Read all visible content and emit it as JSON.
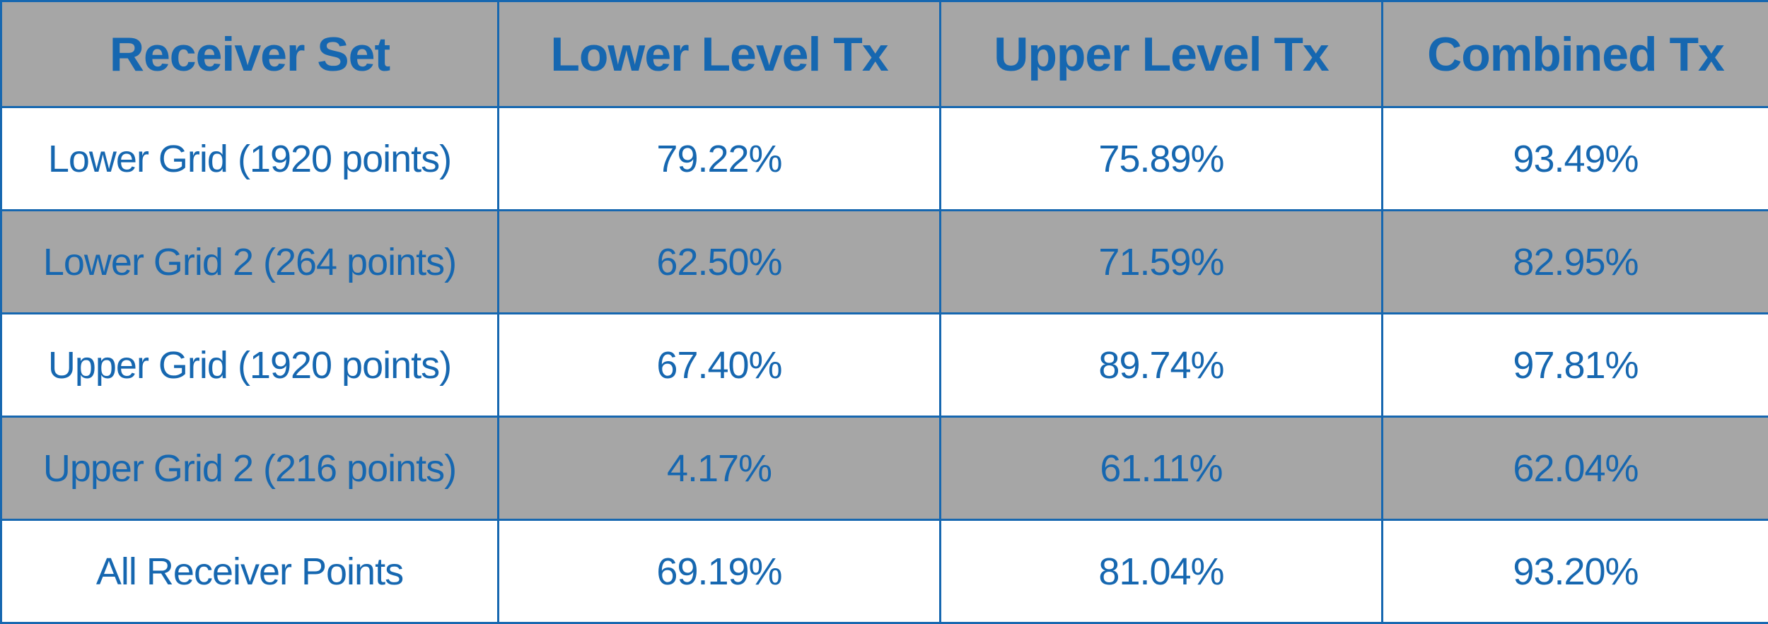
{
  "table": {
    "colors": {
      "text": "#1667b0",
      "border": "#1667b0",
      "header_bg": "#a6a6a6",
      "shaded_row_bg": "#a6a6a6",
      "plain_row_bg": "#ffffff"
    },
    "headers": [
      "Receiver Set",
      "Lower Level Tx",
      "Upper Level Tx",
      "Combined Tx"
    ],
    "rows": [
      {
        "label": "Lower Grid (1920 points)",
        "lower": "79.22%",
        "upper": "75.89%",
        "combined": "93.49%"
      },
      {
        "label": "Lower Grid 2 (264 points)",
        "lower": "62.50%",
        "upper": "71.59%",
        "combined": "82.95%"
      },
      {
        "label": "Upper Grid (1920 points)",
        "lower": "67.40%",
        "upper": "89.74%",
        "combined": "97.81%"
      },
      {
        "label": "Upper Grid 2 (216 points)",
        "lower": "4.17%",
        "upper": "61.11%",
        "combined": "62.04%"
      },
      {
        "label": "All Receiver Points",
        "lower": "69.19%",
        "upper": "81.04%",
        "combined": "93.20%"
      }
    ]
  }
}
